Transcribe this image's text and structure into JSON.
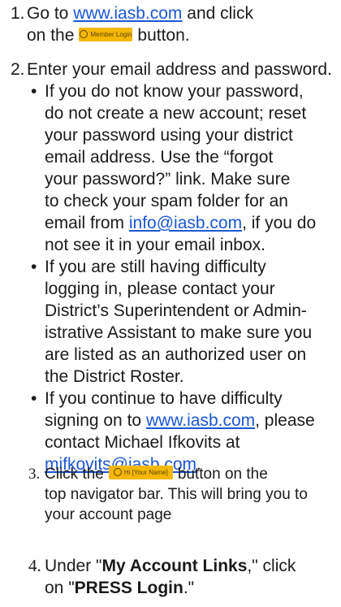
{
  "steps": {
    "s1": {
      "num": "1.",
      "pre": "Go to",
      "link": "www.iasb.com",
      "mid": "and click",
      "l2pre": "on the",
      "button": "Member Login",
      "post": "button."
    },
    "s2": {
      "num": "2.",
      "text": "Enter your email address and password."
    },
    "bullets": {
      "b1": {
        "l1": "If you do not know your password,",
        "l2": "do not create a new account; reset",
        "l3": "your password using your district",
        "l4": "email address. Use the “forgot",
        "l5": "your password?” link. Make sure",
        "l6": "to check your spam folder for an",
        "l7pre": "email from",
        "l7link": "info@iasb.com",
        "l7post": ", if you do",
        "l8": "not see it in your email inbox."
      },
      "b2": {
        "l1": "If you are still having difficulty",
        "l2": "logging in, please contact your",
        "l3": "District’s Superintendent or Admin-",
        "l4": "istrative Assistant to make sure you",
        "l5": "are listed as an authorized user on",
        "l6": "the District Roster."
      },
      "b3": {
        "l1": "If you continue to have difficulty",
        "l2pre": "signing on to",
        "l2link": "www.iasb.com",
        "l2post": ", please",
        "l3": "contact Michael Ifkovits at",
        "l4link": "mifkovits@iasb.com",
        "l4post": "."
      }
    },
    "s3": {
      "num": "3.",
      "pre": "Click the",
      "button": "Hi [Your Name]",
      "post": "button on the",
      "l2": "top navigator bar. This will bring you to",
      "l3": "your account page"
    },
    "s4": {
      "num": "4.",
      "pre": "Under \"",
      "bold1": "My Account Links",
      "mid": ",\" click",
      "l2pre": "on \"",
      "bold2": "PRESS Login",
      "l2post": ".\""
    }
  },
  "colors": {
    "link": "#1a57d6",
    "button": "#f5b700",
    "text": "#1b1b1b"
  }
}
